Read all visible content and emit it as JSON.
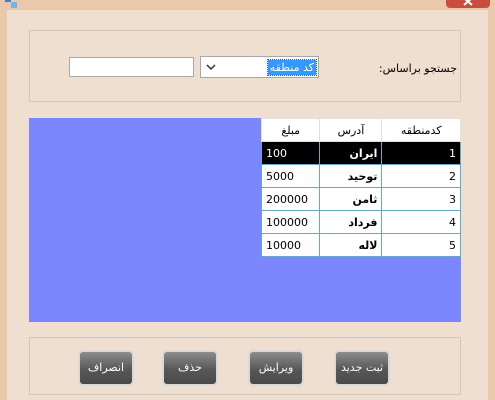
{
  "search": {
    "label": "جستجو براساس:",
    "combo_value": "کد منطقه",
    "text_value": ""
  },
  "grid": {
    "headers": [
      "کدمنطقه",
      "آدرس",
      "مبلغ"
    ],
    "rows": [
      {
        "code": "1",
        "address": "ایران",
        "amount": "100",
        "selected": true
      },
      {
        "code": "2",
        "address": "توحید",
        "amount": "5000"
      },
      {
        "code": "3",
        "address": "ثامن",
        "amount": "200000"
      },
      {
        "code": "4",
        "address": "فرداد",
        "amount": "100000"
      },
      {
        "code": "5",
        "address": "لاله",
        "amount": "10000"
      }
    ]
  },
  "buttons": {
    "new": "ثبت جدید",
    "edit": "ویرایش",
    "delete": "حذف",
    "cancel": "انصراف"
  },
  "icons": {
    "app": "app-icon",
    "close": "close-icon",
    "dropdown": "chevron-down-icon"
  },
  "colors": {
    "grid_background": "#7b86ff",
    "selection": "#3399ff",
    "close_button": "#c94c3d"
  }
}
